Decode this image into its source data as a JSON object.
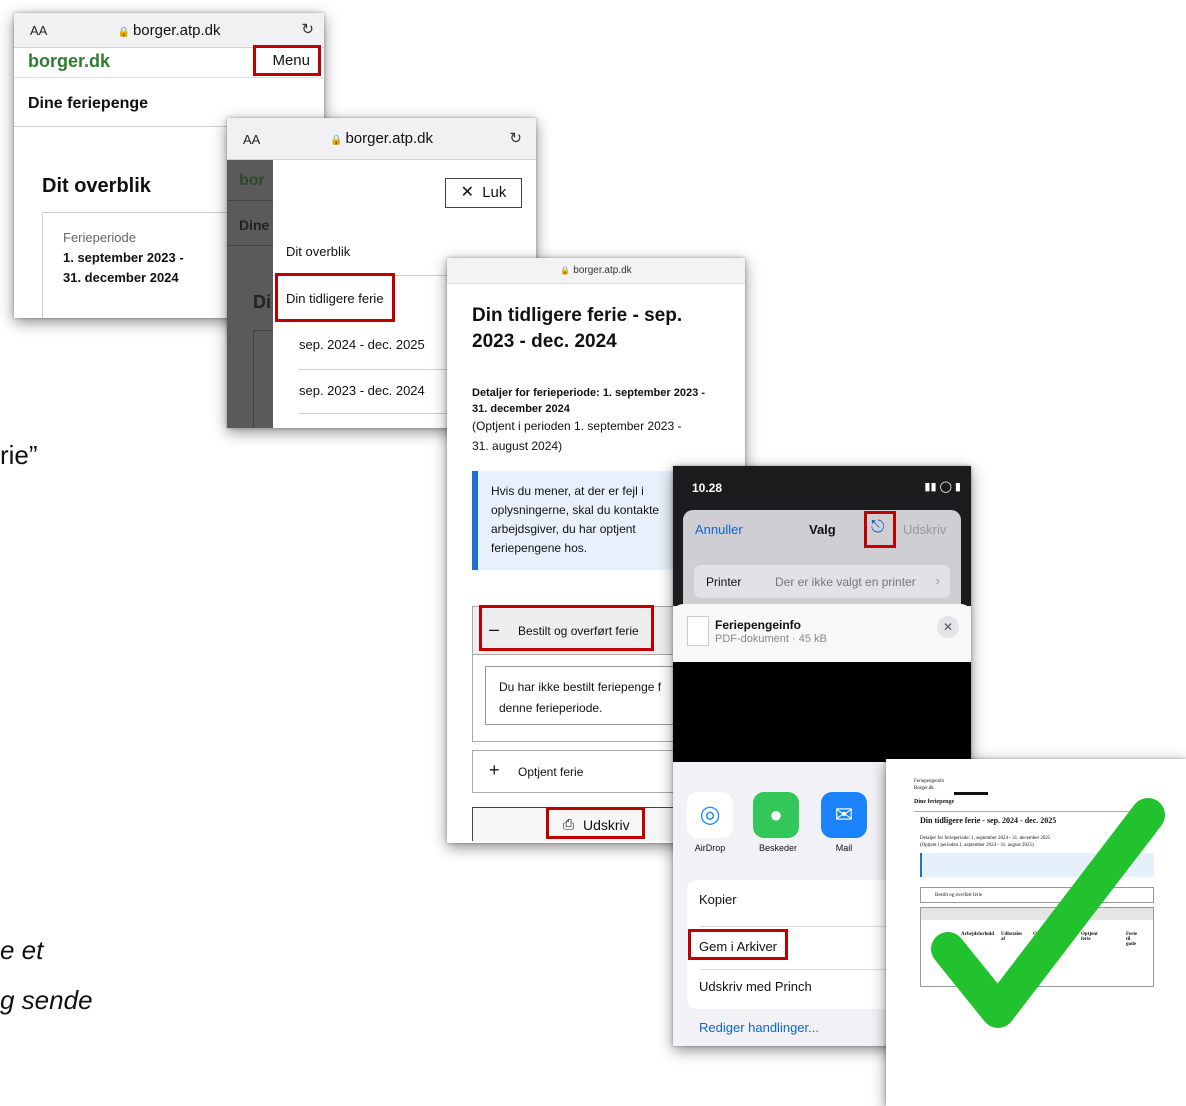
{
  "fragments": {
    "quote_tail": "rie”",
    "italic_line1": "e et",
    "italic_line2": "g sende"
  },
  "screen1": {
    "aa": "AA",
    "url": "borger.atp.dk",
    "logo": "borger.dk",
    "menu_button": "Menu",
    "section_title": "Dine feriepenge",
    "heading": "Dit overblik",
    "period_label": "Ferieperiode",
    "period_value_1": "1. september 2023 -",
    "period_value_2": "31. december 2024"
  },
  "screen2": {
    "aa": "AA",
    "url": "borger.atp.dk",
    "close_button": "Luk",
    "bg_logo_fragment": "bor",
    "bg_section_fragment": "Dine",
    "bg_heading_fragment": "Di",
    "menu_items": [
      "Dit overblik",
      "Din tidligere ferie",
      "sep. 2024 - dec. 2025",
      "sep. 2023 - dec. 2024"
    ]
  },
  "screen3": {
    "url": "borger.atp.dk",
    "title_1": "Din tidligere ferie - sep.",
    "title_2": "2023 - dec. 2024",
    "details_bold_1": "Detaljer for ferieperiode: 1. september 2023 -",
    "details_bold_2": "31. december 2024",
    "details_normal_1": "(Optjent i perioden 1. september 2023 -",
    "details_normal_2": "31. august 2024)",
    "info_lines": [
      "Hvis du mener, at der er fejl i",
      "oplysningerne, skal du kontakte",
      "arbejdsgiver, du har optjent",
      "feriepengene hos."
    ],
    "accordion1_label": "Bestilt og overført ferie",
    "accordion1_body_1": "Du har ikke bestilt feriepenge f",
    "accordion1_body_2": "denne ferieperiode.",
    "accordion2_label": "Optjent ferie",
    "print_button": "Udskriv"
  },
  "screen4": {
    "time": "10.28",
    "cancel": "Annuller",
    "title": "Valg",
    "print": "Udskriv",
    "printer_label": "Printer",
    "printer_value": "Der er ikke valgt en printer",
    "file_name": "Feriepengeinfo",
    "file_meta": "PDF-dokument · 45 kB",
    "share_apps": [
      "AirDrop",
      "Beskeder",
      "Mail"
    ],
    "actions": [
      "Kopier",
      "Gem i Arkiver",
      "Udskriv med Princh"
    ],
    "edit_actions": "Rediger handlinger..."
  },
  "screen5": {
    "small_lines": [
      "Feriepengeinfo",
      "Borger.dk"
    ],
    "section": "Dine feriepenge",
    "title": "Din tidligere ferie - sep. 2024 - dec. 2025",
    "details": "Detaljer for ferieperiode: 1. september 2024 - 31. december 2025",
    "details2": "(Optjent i perioden 1. september 2024 - 31. august 2025)",
    "accordion": "Bestilt og overført ferie",
    "col_headers": [
      "Arbejdsforhold",
      "Udbetales af",
      "Optjent ferie",
      "Optjent ferie",
      "Ferie til gode"
    ],
    "checkmark_color": "#22c22e"
  },
  "colors": {
    "highlight": "#c00000",
    "link_blue": "#0a64dc",
    "borger_green": "#2f7d32",
    "info_blue": "#e8f1fb"
  }
}
